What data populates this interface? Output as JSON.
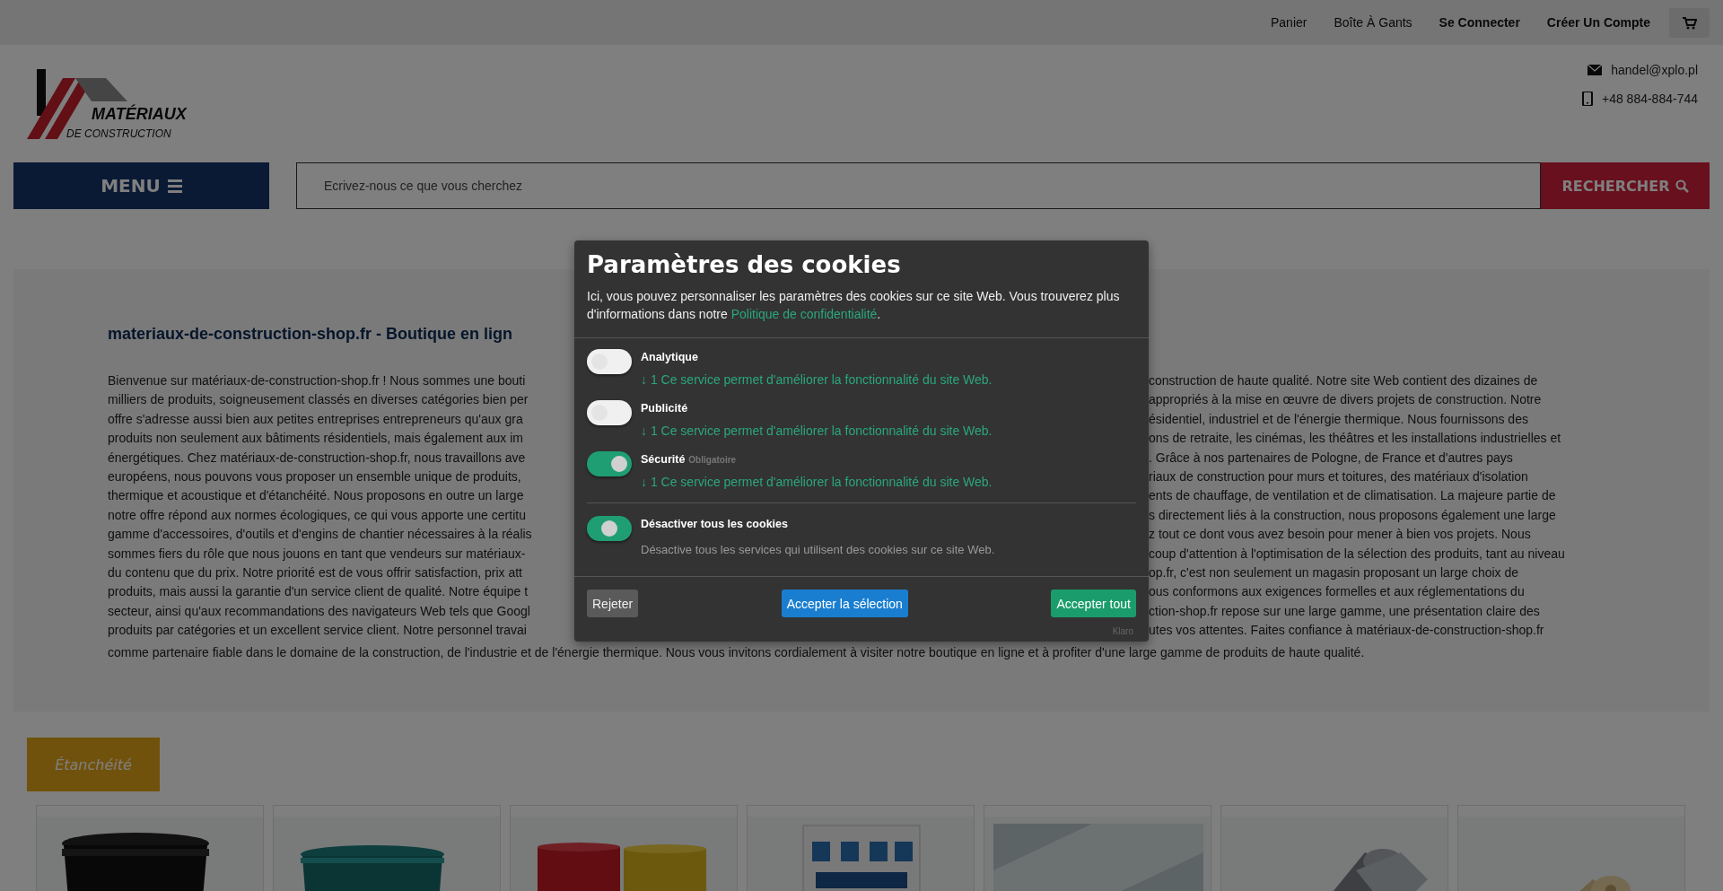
{
  "top_bar": {
    "links": [
      {
        "label": "Panier",
        "bold": false
      },
      {
        "label": "Boîte À Gants",
        "bold": false
      },
      {
        "label": "Se Connecter",
        "bold": true
      },
      {
        "label": "Créer Un Compte",
        "bold": true
      }
    ]
  },
  "header": {
    "logo": {
      "title": "MATÉRIAUX",
      "subtitle": "DE CONSTRUCTION"
    },
    "contacts": [
      {
        "kind": "email",
        "text": "handel@xplo.pl"
      },
      {
        "kind": "phone",
        "text": "+48 884-884-744"
      }
    ]
  },
  "nav": {
    "menu_label": "MENU",
    "search": {
      "placeholder": "Ecrivez-nous ce que vous cherchez"
    },
    "search_button": "RECHERCHER"
  },
  "intro": {
    "heading": "materiaux-de-construction-shop.fr - Boutique en lign",
    "lines": [
      {
        "left": "Bienvenue sur matériaux-de-construction-shop.fr ! Nous sommes une bouti",
        "right": "construction de haute qualité. Notre site Web contient des dizaines de"
      },
      {
        "left": "milliers de produits, soigneusement classés en diverses catégories bien per",
        "right": "appropriés à la mise en œuvre de divers projets de construction. Notre"
      },
      {
        "left": "offre s'adresse aussi bien aux petites entreprises entrepreneurs qu'aux gra",
        "right": "ésidentiel, industriel et de l'énergie thermique. Nous fournissons des"
      },
      {
        "left": "produits non seulement aux bâtiments résidentiels, mais également aux im",
        "right": "ons de retraite, les cinémas, les théâtres et les installations industrielles et"
      },
      {
        "left": "énergétiques. Chez matériaux-de-construction-shop.fr, nous travaillons ave",
        "right": ". Grâce à nos partenaires de Pologne, de France et d'autres pays"
      },
      {
        "left": "européens, nous pouvons vous proposer un ensemble unique de produits,",
        "right": "riaux de construction pour murs et toitures, des matériaux d'isolation"
      },
      {
        "left": "thermique et acoustique et d'étanchéité. Nous proposons en outre un large",
        "right": "ents de chauffage, de ventilation et de climatisation. La majeure partie de"
      },
      {
        "left": "notre offre répond aux normes écologiques, ce qui vous apporte une certitu",
        "right": "s directement liés à la construction, nous proposons également une large"
      },
      {
        "left": "gamme d'accessoires, d'outils et d'engins de chantier nécessaires à la réalis",
        "right": "z tout ce dont vous avez besoin pour mener à bien vos projets. Nous"
      },
      {
        "left": "sommes fiers du rôle que nous jouons en tant que vendeurs sur matériaux-",
        "right": "coup d'attention à l'optimisation de la sélection des produits, tant au niveau"
      },
      {
        "left": "du contenu que du prix. Notre priorité est de vous offrir satisfaction, prix att",
        "right": "op.fr, c'est non seulement un magasin proposant un large choix de"
      },
      {
        "left": "produits, mais aussi la garantie d'un service client de qualité. Notre équipe t",
        "right": "ous conformons aux exigences formelles et aux réglementations du"
      },
      {
        "left": "secteur, ainsi qu'aux recommandations des navigateurs Web tels que Googl",
        "right": "ction-shop.fr repose sur une large gamme, une présentation claire des"
      },
      {
        "left": "produits par catégories et un excellent service client. Notre personnel travai",
        "right": "utes vos attentes. Faites confiance à matériaux-de-construction-shop.fr"
      }
    ],
    "last_line": "comme partenaire fiable dans le domaine de la construction, de l'industrie et de l'énergie thermique. Nous vous invitons cordialement à visiter notre boutique en ligne et à profiter d'une large gamme de produits de haute qualité."
  },
  "category": {
    "label": "Étanchéité"
  },
  "cookie_modal": {
    "title": "Paramètres des cookies",
    "intro": "Ici, vous pouvez personnaliser les paramètres des cookies sur ce site Web. Vous trouverez plus d'informations dans notre ",
    "privacy_link": "Politique de confidentialité",
    "intro_end": ".",
    "services": [
      {
        "name": "Analytique",
        "on": false,
        "description": "↓ 1 Ce service permet d'améliorer la fonctionnalité du site Web."
      },
      {
        "name": "Publicité",
        "on": false,
        "description": "↓ 1 Ce service permet d'améliorer la fonctionnalité du site Web."
      },
      {
        "name": "Sécurité",
        "badge": "Obligatoire",
        "on": true,
        "description": "↓ 1 Ce service permet d'améliorer la fonctionnalité du site Web."
      }
    ],
    "toggle_all": {
      "label": "Désactiver tous les cookies",
      "on": true,
      "description": "Désactive tous les services qui utilisent des cookies sur ce site Web."
    },
    "buttons": [
      {
        "kind": "reject",
        "label": "Rejeter"
      },
      {
        "kind": "accept_selection",
        "label": "Accepter la sélection"
      },
      {
        "kind": "accept_all",
        "label": "Accepter tout"
      }
    ],
    "powered_by": "Klaro"
  }
}
